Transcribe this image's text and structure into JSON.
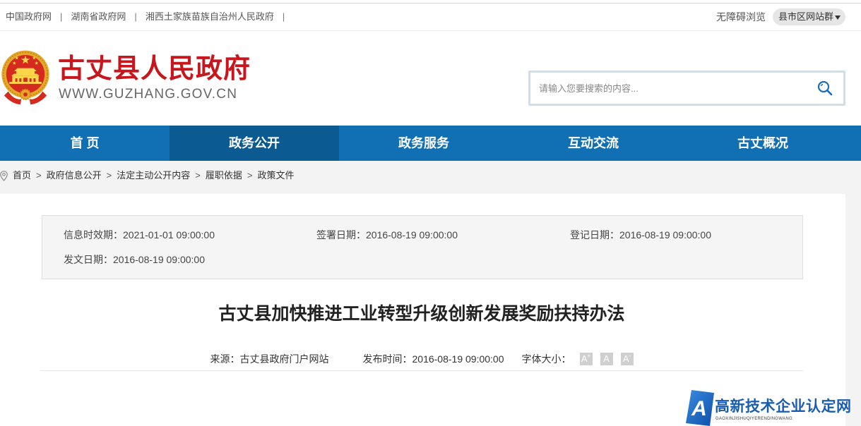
{
  "topbar": {
    "links": [
      {
        "label": "中国政府网"
      },
      {
        "label": "湖南省政府网"
      },
      {
        "label": "湘西土家族苗族自治州人民政府"
      }
    ],
    "separator": "|",
    "accessibility_label": "无障碍浏览",
    "site_group_label": "县市区网站群",
    "site_group_icon": "caret-down-icon"
  },
  "header": {
    "emblem_icon": "national-emblem-icon",
    "site_title": "古丈县人民政府",
    "site_url": "WWW.GUZHANG.GOV.CN"
  },
  "search": {
    "placeholder": "请输入您要搜索的内容...",
    "icon": "search-icon"
  },
  "nav": {
    "items": [
      {
        "label": "首 页",
        "active": false
      },
      {
        "label": "政务公开",
        "active": true
      },
      {
        "label": "政务服务",
        "active": false
      },
      {
        "label": "互动交流",
        "active": false
      },
      {
        "label": "古丈概况",
        "active": false
      }
    ]
  },
  "breadcrumb": {
    "icon": "location-pin-icon",
    "separator": ">",
    "items": [
      "首页",
      "政府信息公开",
      "法定主动公开内容",
      "履职依据",
      "政策文件"
    ]
  },
  "info_panel": {
    "validity": {
      "label": "信息时效期：",
      "value": "2021-01-01 09:00:00"
    },
    "signed_date": {
      "label": "签署日期：",
      "value": "2016-08-19 09:00:00"
    },
    "registered_date": {
      "label": "登记日期：",
      "value": "2016-08-19 09:00:00"
    },
    "issued_date": {
      "label": "发文日期：",
      "value": "2016-08-19 09:00:00"
    }
  },
  "article": {
    "title": "古丈县加快推进工业转型升级创新发展奖励扶持办法",
    "source_label": "来源：",
    "source": "古丈县政府门户网站",
    "publish_label": "发布时间：",
    "publish_time": "2016-08-19 09:00:00",
    "font_size_label": "字体大小：",
    "font_size_buttons": [
      {
        "letter": "A",
        "sup": "+"
      },
      {
        "letter": "A",
        "sup": ""
      },
      {
        "letter": "A",
        "sup": "-"
      }
    ]
  },
  "watermark": {
    "logo_letter": "A",
    "name": "高新技术企业认定网",
    "pinyin": "GAOXINJISHUQIYERENDINGWANG"
  },
  "colors": {
    "brand_red": "#c8161d",
    "nav_blue": "#1170b3",
    "nav_active_blue": "#0b5a92",
    "link_blue": "#1d6db4",
    "watermark_blue": "#1a5db0"
  }
}
